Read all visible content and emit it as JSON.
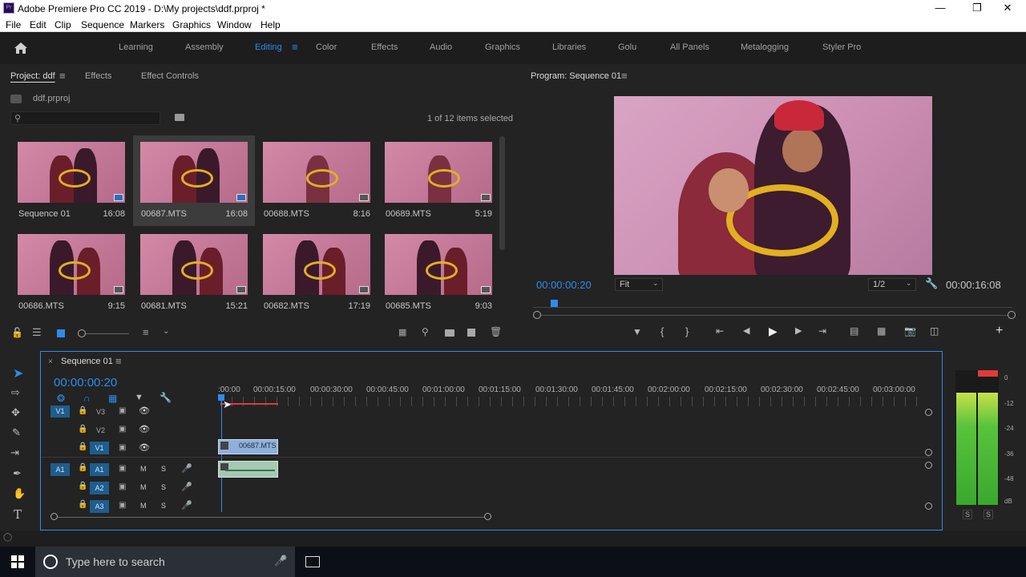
{
  "window": {
    "app_icon": "Pr",
    "title": "Adobe Premiere Pro CC 2019 - D:\\My projects\\ddf.prproj *",
    "controls": [
      "minimize",
      "restore",
      "close"
    ]
  },
  "menu": [
    "File",
    "Edit",
    "Clip",
    "Sequence",
    "Markers",
    "Graphics",
    "Window",
    "Help"
  ],
  "workspaces": {
    "items": [
      "Learning",
      "Assembly",
      "Editing",
      "Color",
      "Effects",
      "Audio",
      "Graphics",
      "Libraries",
      "Golu",
      "All Panels",
      "Metalogging",
      "Styler Pro"
    ],
    "active": "Editing"
  },
  "project_panel": {
    "tabs": [
      "Project: ddf",
      "Effects",
      "Effect Controls"
    ],
    "project_file": "ddf.prproj",
    "search_placeholder": "",
    "selection_status": "1 of 12 items selected",
    "items": [
      {
        "name": "Sequence 01",
        "duration": "16:08",
        "selected": false
      },
      {
        "name": "00687.MTS",
        "duration": "16:08",
        "selected": true
      },
      {
        "name": "00688.MTS",
        "duration": "8:16",
        "selected": false
      },
      {
        "name": "00689.MTS",
        "duration": "5:19",
        "selected": false
      },
      {
        "name": "00686.MTS",
        "duration": "9:15",
        "selected": false
      },
      {
        "name": "00681.MTS",
        "duration": "15:21",
        "selected": false
      },
      {
        "name": "00682.MTS",
        "duration": "17:19",
        "selected": false
      },
      {
        "name": "00685.MTS",
        "duration": "9:03",
        "selected": false
      }
    ]
  },
  "program_monitor": {
    "title": "Program: Sequence 01",
    "current_time": "00:00:00:20",
    "zoom": "Fit",
    "resolution": "1/2",
    "duration": "00:00:16:08"
  },
  "timeline": {
    "sequence_name": "Sequence 01",
    "current_time": "00:00:00:20",
    "ruler": [
      ":00:00",
      "00:00:15:00",
      "00:00:30:00",
      "00:00:45:00",
      "00:01:00:00",
      "00:01:15:00",
      "00:01:30:00",
      "00:01:45:00",
      "00:02:00:00",
      "00:02:15:00",
      "00:02:30:00",
      "00:02:45:00",
      "00:03:00:00"
    ],
    "video_tracks": [
      "V3",
      "V2",
      "V1"
    ],
    "audio_tracks": [
      "A1",
      "A2",
      "A3"
    ],
    "source_patch_video": "V1",
    "source_patch_audio": "A1",
    "track_toggle_m": "M",
    "track_toggle_s": "S",
    "clip_video_label": "00687.MTS"
  },
  "audio_meter": {
    "scale": [
      "0",
      "-12",
      "-24",
      "-36",
      "-48",
      "dB"
    ],
    "solo_labels": [
      "S",
      "S"
    ]
  },
  "taskbar": {
    "search_placeholder": "Type here to search"
  }
}
